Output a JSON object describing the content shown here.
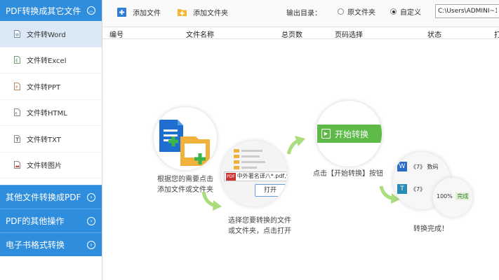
{
  "sidebar": {
    "header": "PDF转换成其它文件",
    "items": [
      {
        "label": "文件转Word",
        "icon": "word-file-icon",
        "active": true
      },
      {
        "label": "文件转Excel",
        "icon": "excel-file-icon",
        "active": false
      },
      {
        "label": "文件转PPT",
        "icon": "ppt-file-icon",
        "active": false
      },
      {
        "label": "文件转HTML",
        "icon": "html-file-icon",
        "active": false
      },
      {
        "label": "文件转TXT",
        "icon": "txt-file-icon",
        "active": false
      },
      {
        "label": "文件转图片",
        "icon": "image-file-icon",
        "active": false
      }
    ],
    "sections": [
      {
        "label": "其他文件转换成PDF"
      },
      {
        "label": "PDF的其他操作"
      },
      {
        "label": "电子书格式转换"
      }
    ]
  },
  "toolbar": {
    "add_file": "添加文件",
    "add_folder": "添加文件夹",
    "output_label": "输出目录：",
    "radio_original": "原文件夹",
    "radio_custom": "自定义",
    "custom_selected": true,
    "path_value": "C:\\Users\\ADMINI~1\\"
  },
  "table": {
    "columns": [
      "编号",
      "文件名称",
      "总页数",
      "页码选择",
      "状态",
      "打"
    ]
  },
  "guide": {
    "step1_caption_line1": "根据您的需要点击",
    "step1_caption_line2": "添加文件或文件夹",
    "step2_filename": "中外著名译八*.pdf,*",
    "step2_open": "打开",
    "step2_caption_line1": "选择您要转换的文件",
    "step2_caption_line2": "或文件夹，点击打开",
    "step3_button": "开始转换",
    "step3_caption": "点击【开始转换】按钮",
    "step4_item1": "《7》 数码",
    "step4_item2": "《7》",
    "step4_progress": "100%",
    "step4_done_label": "完成",
    "step4_caption": "转换完成！"
  },
  "colors": {
    "accent": "#2e8ddc",
    "green": "#6cc24a",
    "arrow_green": "#a9dd7e"
  }
}
